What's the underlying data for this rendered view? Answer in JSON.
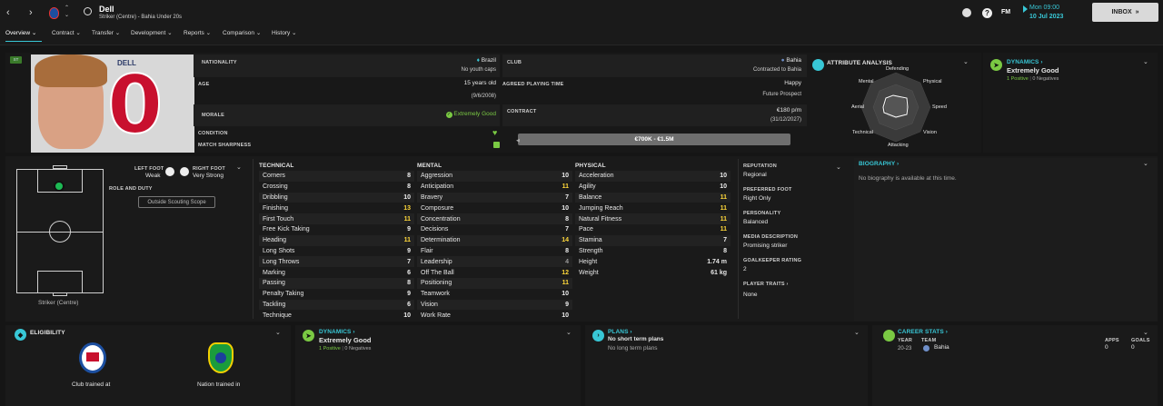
{
  "topbar": {
    "player_name": "Dell",
    "subtitle": "Striker (Centre) - Bahia Under 20s",
    "date_time": "Mon 09:00",
    "date": "10 Jul 2023",
    "fm_label": "FM",
    "help_label": "?",
    "inbox_label": "INBOX"
  },
  "tabs": [
    "Overview",
    "Contract",
    "Transfer",
    "Development",
    "Reports",
    "Comparison",
    "History"
  ],
  "profile": {
    "badge": "ST",
    "shirt_name": "DELL",
    "shirt_number": "0"
  },
  "info": {
    "nationality_label": "NATIONALITY",
    "nationality": "Brazil",
    "youth_caps": "No youth caps",
    "club_label": "CLUB",
    "club": "Bahia",
    "contracted_to": "Contracted to Bahia",
    "age_label": "AGE",
    "age": "15 years old",
    "dob": "(9/6/2008)",
    "apt_label": "AGREED PLAYING TIME",
    "apt": "Happy",
    "apt_sub": "Future Prospect",
    "morale_label": "MORALE",
    "morale": "Extremely Good",
    "contract_label": "CONTRACT",
    "wage": "€180 p/m",
    "contract_end": "(31/12/2027)",
    "condition_label": "CONDITION",
    "sharpness_label": "MATCH SHARPNESS",
    "value_range": "€700K - €1.5M"
  },
  "attribute_analysis": {
    "title": "ATTRIBUTE ANALYSIS",
    "labels": [
      "Defending",
      "Physical",
      "Speed",
      "Vision",
      "Attacking",
      "Technical",
      "Aerial",
      "Mental"
    ]
  },
  "dynamics_top": {
    "title": "DYNAMICS",
    "value": "Extremely Good",
    "positive": "1 Positive",
    "negatives": "0 Negatives"
  },
  "position": {
    "left_foot_label": "LEFT FOOT",
    "left_foot": "Weak",
    "right_foot_label": "RIGHT FOOT",
    "right_foot": "Very Strong",
    "role_label": "ROLE AND DUTY",
    "scouting_button": "Outside Scouting Scope",
    "position_name": "Striker (Centre)"
  },
  "technical": {
    "title": "TECHNICAL",
    "rows": [
      {
        "name": "Corners",
        "value": "8"
      },
      {
        "name": "Crossing",
        "value": "8"
      },
      {
        "name": "Dribbling",
        "value": "10"
      },
      {
        "name": "Finishing",
        "value": "13"
      },
      {
        "name": "First Touch",
        "value": "11"
      },
      {
        "name": "Free Kick Taking",
        "value": "9"
      },
      {
        "name": "Heading",
        "value": "11"
      },
      {
        "name": "Long Shots",
        "value": "9"
      },
      {
        "name": "Long Throws",
        "value": "7"
      },
      {
        "name": "Marking",
        "value": "6"
      },
      {
        "name": "Passing",
        "value": "8"
      },
      {
        "name": "Penalty Taking",
        "value": "9"
      },
      {
        "name": "Tackling",
        "value": "6"
      },
      {
        "name": "Technique",
        "value": "10"
      }
    ]
  },
  "mental": {
    "title": "MENTAL",
    "rows": [
      {
        "name": "Aggression",
        "value": "10"
      },
      {
        "name": "Anticipation",
        "value": "11"
      },
      {
        "name": "Bravery",
        "value": "7"
      },
      {
        "name": "Composure",
        "value": "10"
      },
      {
        "name": "Concentration",
        "value": "8"
      },
      {
        "name": "Decisions",
        "value": "7"
      },
      {
        "name": "Determination",
        "value": "14"
      },
      {
        "name": "Flair",
        "value": "8"
      },
      {
        "name": "Leadership",
        "value": "4"
      },
      {
        "name": "Off The Ball",
        "value": "12"
      },
      {
        "name": "Positioning",
        "value": "11"
      },
      {
        "name": "Teamwork",
        "value": "10"
      },
      {
        "name": "Vision",
        "value": "9"
      },
      {
        "name": "Work Rate",
        "value": "10"
      }
    ]
  },
  "physical": {
    "title": "PHYSICAL",
    "rows": [
      {
        "name": "Acceleration",
        "value": "10"
      },
      {
        "name": "Agility",
        "value": "10"
      },
      {
        "name": "Balance",
        "value": "11"
      },
      {
        "name": "Jumping Reach",
        "value": "11"
      },
      {
        "name": "Natural Fitness",
        "value": "11"
      },
      {
        "name": "Pace",
        "value": "11"
      },
      {
        "name": "Stamina",
        "value": "7"
      },
      {
        "name": "Strength",
        "value": "8"
      }
    ],
    "height_label": "Height",
    "height": "1.74 m",
    "weight_label": "Weight",
    "weight": "61 kg"
  },
  "details": {
    "reputation_label": "REPUTATION",
    "reputation": "Regional",
    "foot_label": "PREFERRED FOOT",
    "foot": "Right Only",
    "personality_label": "PERSONALITY",
    "personality": "Balanced",
    "media_label": "MEDIA DESCRIPTION",
    "media": "Promising striker",
    "gk_label": "GOALKEEPER RATING",
    "gk": "2",
    "traits_label": "PLAYER TRAITS",
    "traits": "None"
  },
  "biography": {
    "title": "BIOGRAPHY",
    "text": "No biography is available at this time."
  },
  "eligibility": {
    "title": "ELIGIBILITY",
    "club_trained": "Club trained at",
    "nation_trained": "Nation trained in"
  },
  "dynamics_bottom": {
    "title": "DYNAMICS",
    "value": "Extremely Good",
    "positive": "1 Positive",
    "negatives": "0 Negatives"
  },
  "plans": {
    "title": "PLANS",
    "short": "No short term plans",
    "long": "No long term plans"
  },
  "career": {
    "title": "CAREER STATS",
    "year_label": "YEAR",
    "team_label": "TEAM",
    "apps_label": "APPS",
    "goals_label": "GOALS",
    "year": "20-23",
    "team": "Bahia",
    "apps": "0",
    "goals": "0"
  },
  "colors": {
    "accent": "#38c7d6",
    "green": "#7ac943",
    "yellow": "#ffd83a",
    "shirt_red": "#c8102e"
  }
}
